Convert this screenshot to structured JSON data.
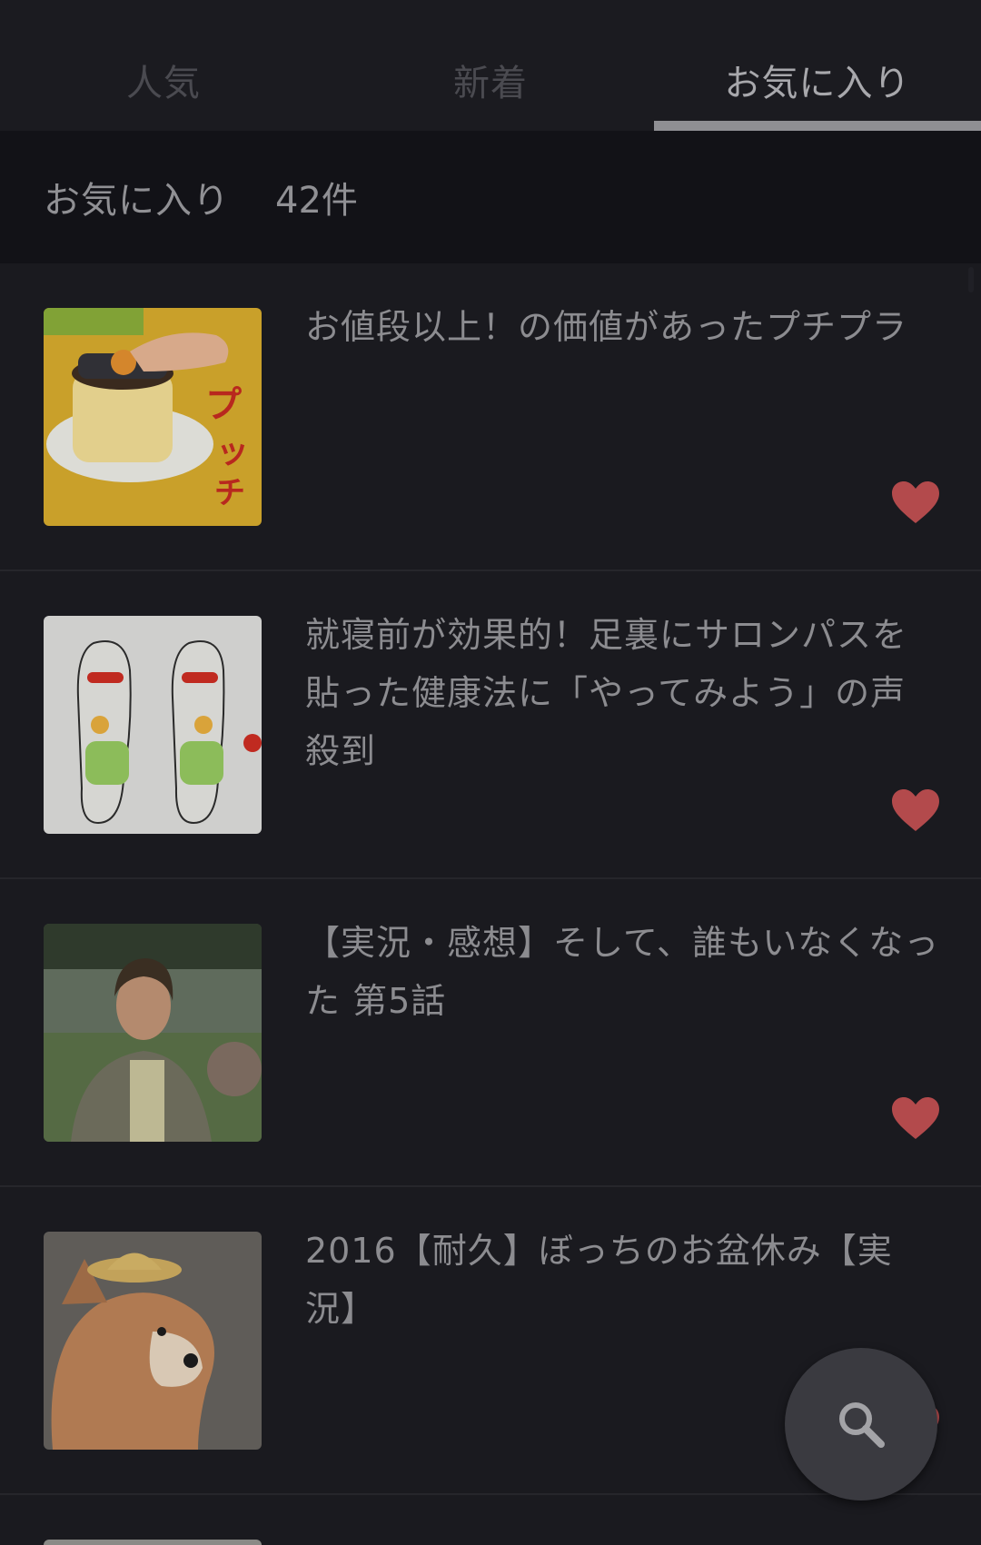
{
  "tabs": [
    {
      "label": "人気"
    },
    {
      "label": "新着"
    },
    {
      "label": "お気に入り"
    }
  ],
  "active_tab": "お気に入り",
  "favorites_header": {
    "label": "お気に入り",
    "count": "42件"
  },
  "items": [
    {
      "title": "お値段以上！の価値があったプチプラ",
      "favorited": true
    },
    {
      "title": "就寝前が効果的！足裏にサロンパスを貼った健康法に「やってみよう」の声殺到",
      "favorited": true
    },
    {
      "title": "【実況・感想】そして、誰もいなくなった 第5話",
      "favorited": true
    },
    {
      "title": "2016【耐久】ぼっちのお盆休み【実況】",
      "favorited": true
    }
  ],
  "colors": {
    "background": "#1a1a1f",
    "tab_indicator": "#8f8f93",
    "heart": "#b34a4c",
    "fab": "#3a3a40"
  },
  "icons": {
    "heart": "heart-icon",
    "search": "search-icon"
  }
}
